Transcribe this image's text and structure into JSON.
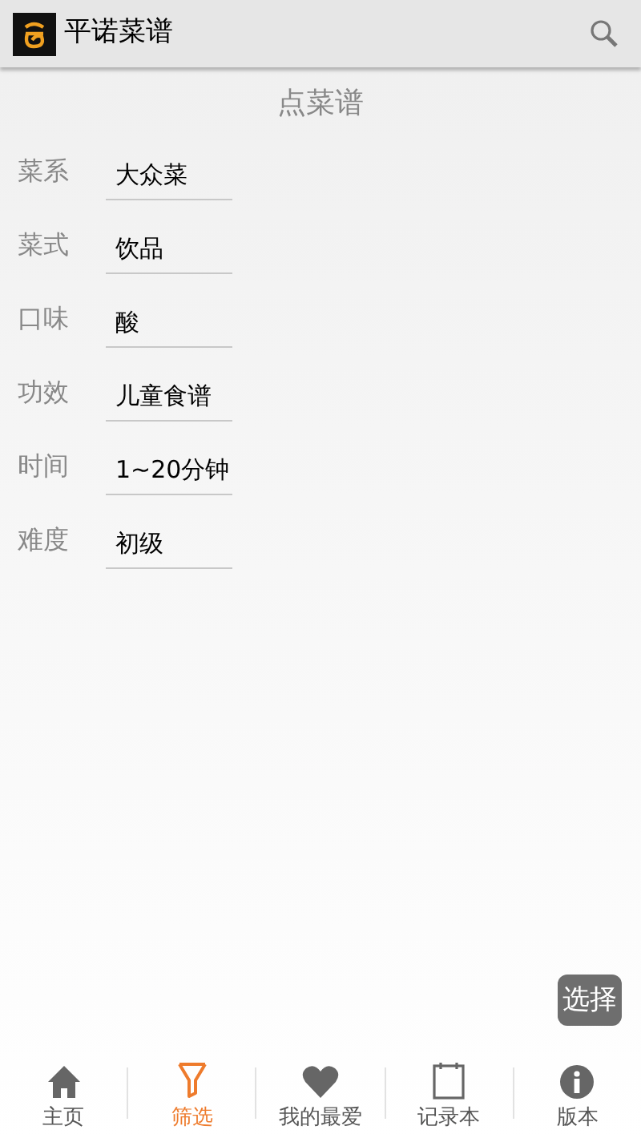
{
  "app_bar": {
    "title": "平诺菜谱"
  },
  "page_title": "点菜谱",
  "fields": [
    {
      "label": "菜系",
      "value": "大众菜"
    },
    {
      "label": "菜式",
      "value": "饮品"
    },
    {
      "label": "口味",
      "value": "酸"
    },
    {
      "label": "功效",
      "value": "儿童食谱"
    },
    {
      "label": "时间",
      "value": "1~20分钟"
    },
    {
      "label": "难度",
      "value": "初级"
    }
  ],
  "select_button": "选择",
  "tabs": [
    {
      "kind": "home",
      "label": "主页",
      "selected": false
    },
    {
      "kind": "filter",
      "label": "筛选",
      "selected": true
    },
    {
      "kind": "favorites",
      "label": "我的最爱",
      "selected": false
    },
    {
      "kind": "notebook",
      "label": "记录本",
      "selected": false
    },
    {
      "kind": "info",
      "label": "版本",
      "selected": false
    }
  ]
}
